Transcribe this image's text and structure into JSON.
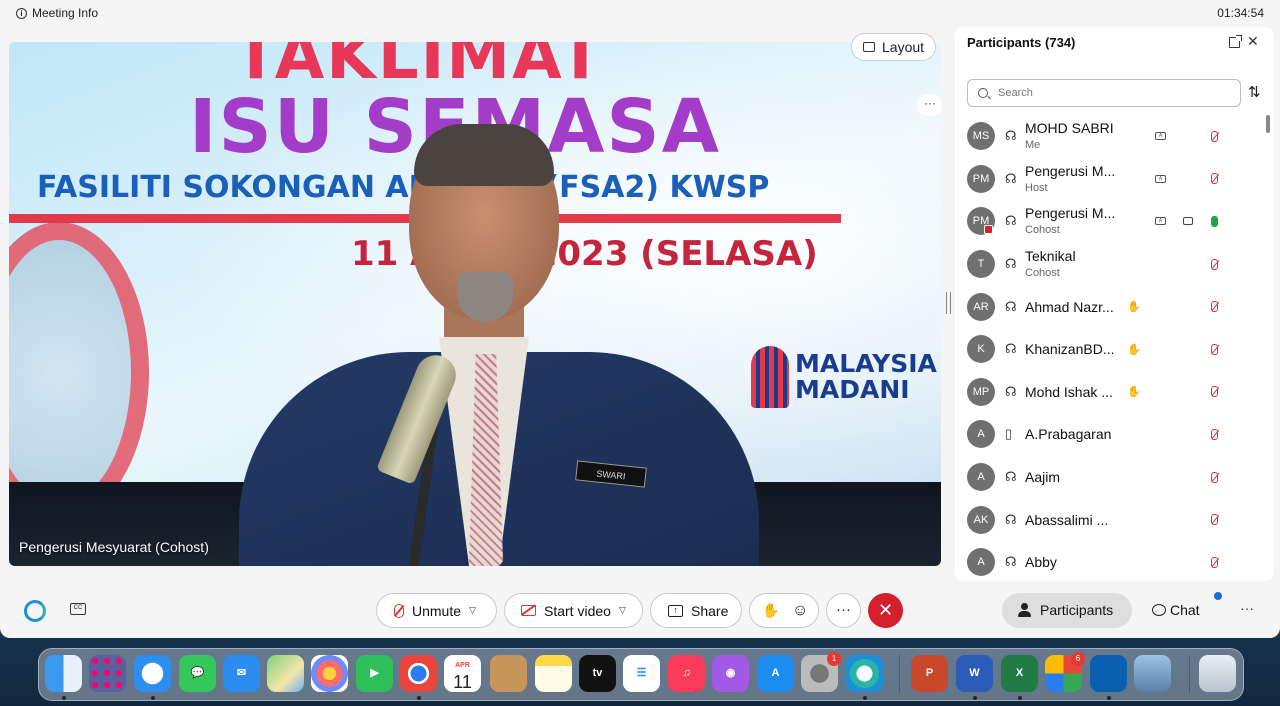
{
  "titlebar": {
    "meeting_info": "Meeting Info",
    "time": "01:34:54"
  },
  "stage": {
    "banner_line1": "TAKLIMAT",
    "banner_line2": "ISU SEMASA",
    "banner_line3": "FASILITI SOKONGAN AKAUN 2 (FSA2) KWSP",
    "banner_date": "11 APRIL 2023 (SELASA)",
    "madani_line1": "MALAYSIA",
    "madani_line2": "MADANI",
    "nametag": "SWARI",
    "speaker_label": "Pengerusi Mesyuarat (Cohost)",
    "layout_button": "Layout",
    "more": "···"
  },
  "participants_panel": {
    "title": "Participants (734)",
    "search_placeholder": "Search",
    "participants": [
      {
        "initials": "MS",
        "name": "MOHD SABRI",
        "role": "Me",
        "conn": "headset",
        "cc": true,
        "mic": "muted"
      },
      {
        "initials": "PM",
        "name": "Pengerusi M...",
        "role": "Host",
        "conn": "headset",
        "cc": true,
        "mic": "muted"
      },
      {
        "initials": "PM",
        "name": "Pengerusi M...",
        "role": "Cohost",
        "conn": "headset",
        "cc": true,
        "video": true,
        "mic": "live",
        "live_badge": true
      },
      {
        "initials": "T",
        "name": "Teknikal",
        "role": "Cohost",
        "conn": "headset",
        "mic": "muted"
      },
      {
        "initials": "AR",
        "name": "Ahmad Nazr...",
        "role": "",
        "conn": "headset",
        "hand": true,
        "mic": "muted"
      },
      {
        "initials": "K",
        "name": "KhanizanBD...",
        "role": "",
        "conn": "headset",
        "hand": true,
        "mic": "muted"
      },
      {
        "initials": "MP",
        "name": "Mohd Ishak ...",
        "role": "",
        "conn": "headset",
        "hand": true,
        "mic": "muted"
      },
      {
        "initials": "A",
        "name": "A.Prabagaran",
        "role": "",
        "conn": "phone",
        "mic": "muted"
      },
      {
        "initials": "A",
        "name": "Aajim",
        "role": "",
        "conn": "headset",
        "mic": "muted"
      },
      {
        "initials": "AK",
        "name": "Abassalimi ...",
        "role": "",
        "conn": "headset",
        "mic": "muted"
      },
      {
        "initials": "A",
        "name": "Abby",
        "role": "",
        "conn": "headset",
        "mic": "muted"
      }
    ]
  },
  "controls": {
    "unmute": "Unmute",
    "start_video": "Start video",
    "share": "Share",
    "participants": "Participants",
    "chat": "Chat"
  },
  "dock": {
    "calendar_month": "APR",
    "calendar_day": "11",
    "tv_label": "tv",
    "settings_badge": "1",
    "app_badge": "6"
  },
  "colors": {
    "accent_blue": "#1c8fd9",
    "end_red": "#d4202d",
    "muted_red": "#dd3333",
    "live_green": "#1ea54a"
  }
}
